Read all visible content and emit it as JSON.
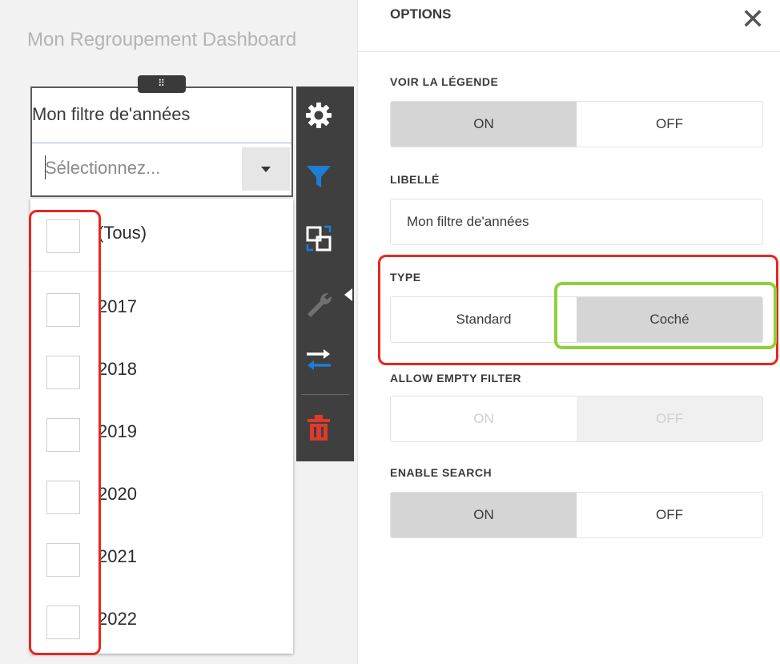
{
  "dashboard": {
    "title": "Mon Regroupement Dashboard",
    "drag_handle": "⠿",
    "widget": {
      "caption": "Mon filtre de'années",
      "select_placeholder": "Sélectionnez...",
      "items": [
        {
          "label": "(Tous)",
          "checked": false
        },
        {
          "label": "2017",
          "checked": false
        },
        {
          "label": "2018",
          "checked": false
        },
        {
          "label": "2019",
          "checked": false
        },
        {
          "label": "2020",
          "checked": false
        },
        {
          "label": "2021",
          "checked": false
        },
        {
          "label": "2022",
          "checked": false
        }
      ]
    }
  },
  "toolbar": {
    "icons": [
      "gear-icon",
      "filter-icon",
      "convert-icon",
      "wrench-icon",
      "swap-icon",
      "trash-icon"
    ],
    "colors": {
      "background": "#3f3f3f",
      "filter": "#1e7ed6",
      "trash": "#e03a2e",
      "wrench": "#707070"
    }
  },
  "options": {
    "title": "OPTIONS",
    "close_symbol": "✕",
    "show_legend": {
      "label": "VOIR LA LÉGENDE",
      "on": "ON",
      "off": "OFF",
      "selected": "on"
    },
    "caption": {
      "label": "LIBELLÉ",
      "value": "Mon filtre de'années"
    },
    "type": {
      "label": "TYPE",
      "standard": "Standard",
      "checked": "Coché",
      "selected": "checked"
    },
    "allow_empty": {
      "label": "ALLOW EMPTY FILTER",
      "on": "ON",
      "off": "OFF",
      "selected": "off",
      "disabled": true
    },
    "enable_search": {
      "label": "ENABLE SEARCH",
      "on": "ON",
      "off": "OFF",
      "selected": "on"
    }
  },
  "annotations": {
    "red": "#e8271f",
    "green": "#8cd23a"
  }
}
